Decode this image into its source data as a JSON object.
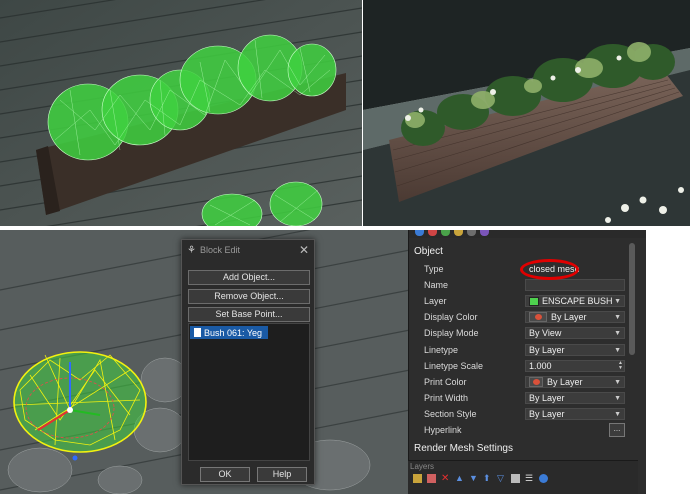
{
  "block_edit": {
    "title": "Block Edit",
    "add_object": "Add Object...",
    "remove_object": "Remove Object...",
    "set_base_point": "Set Base Point...",
    "list_items": [
      "Bush 061: Yeg"
    ],
    "ok": "OK",
    "help": "Help"
  },
  "properties": {
    "section_object": "Object",
    "section_render": "Render Mesh Settings",
    "rows": {
      "type": {
        "label": "Type",
        "value": "closed mesh"
      },
      "name": {
        "label": "Name",
        "value": ""
      },
      "layer": {
        "label": "Layer",
        "value": "ENSCAPE BUSH"
      },
      "display_color": {
        "label": "Display Color",
        "value": "By Layer"
      },
      "display_mode": {
        "label": "Display Mode",
        "value": "By View"
      },
      "linetype": {
        "label": "Linetype",
        "value": "By Layer"
      },
      "linetype_scale": {
        "label": "Linetype Scale",
        "value": "1.000"
      },
      "print_color": {
        "label": "Print Color",
        "value": "By Layer"
      },
      "print_width": {
        "label": "Print Width",
        "value": "By Layer"
      },
      "section_style": {
        "label": "Section Style",
        "value": "By Layer"
      },
      "hyperlink": {
        "label": "Hyperlink",
        "button": "..."
      }
    },
    "layer_color": "#4ed14e"
  },
  "layers_panel": {
    "tab": "Layers",
    "tools": [
      "new-layer-icon",
      "new-sublayer-icon",
      "delete-icon",
      "up-icon",
      "down-icon",
      "up-parent-icon",
      "filter-icon",
      "grid-icon",
      "list-icon",
      "help-icon"
    ]
  },
  "colors": {
    "wire_green": "#3fd13f",
    "selection_yellow": "#f2f20f",
    "highlight_red": "#e00000",
    "panel_bg": "#2d2d2d",
    "list_selection": "#1a5aa5"
  }
}
